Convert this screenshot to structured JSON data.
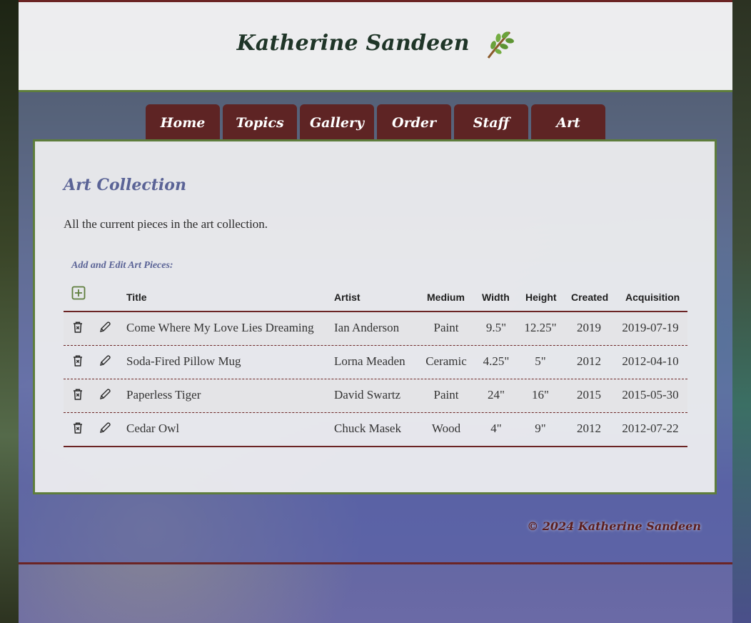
{
  "header": {
    "title": "Katherine Sandeen"
  },
  "nav": [
    "Home",
    "Topics",
    "Gallery",
    "Order",
    "Staff",
    "Art"
  ],
  "content": {
    "title": "Art Collection",
    "description": "All the current pieces in the art collection.",
    "section_label": "Add and Edit Art Pieces:"
  },
  "table": {
    "headers": {
      "title": "Title",
      "artist": "Artist",
      "medium": "Medium",
      "width": "Width",
      "height": "Height",
      "created": "Created",
      "acquisition": "Acquisition"
    },
    "rows": [
      {
        "title": "Come Where My Love Lies Dreaming",
        "artist": "Ian Anderson",
        "medium": "Paint",
        "width": "9.5\"",
        "height": "12.25\"",
        "created": "2019",
        "acquisition": "2019-07-19"
      },
      {
        "title": "Soda-Fired Pillow Mug",
        "artist": "Lorna Meaden",
        "medium": "Ceramic",
        "width": "4.25\"",
        "height": "5\"",
        "created": "2012",
        "acquisition": "2012-04-10"
      },
      {
        "title": "Paperless Tiger",
        "artist": "David Swartz",
        "medium": "Paint",
        "width": "24\"",
        "height": "16\"",
        "created": "2015",
        "acquisition": "2015-05-30"
      },
      {
        "title": "Cedar Owl",
        "artist": "Chuck Masek",
        "medium": "Wood",
        "width": "4\"",
        "height": "9\"",
        "created": "2012",
        "acquisition": "2012-07-22"
      }
    ]
  },
  "footer": {
    "copyright": "© 2024 Katherine Sandeen"
  },
  "icons": {
    "add": "plus-square-icon",
    "delete": "trash-icon",
    "edit": "pencil-icon",
    "logo": "leaf-sprig-icon"
  },
  "colors": {
    "accent_green": "#5e7d3c",
    "nav_maroon": "#5e2424",
    "heading_blue": "#5a6396"
  }
}
